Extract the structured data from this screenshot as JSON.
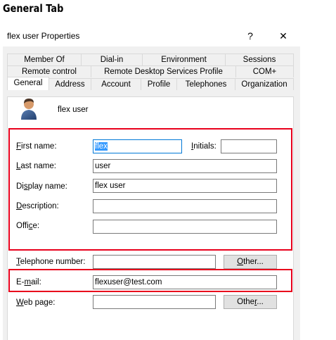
{
  "heading": "General Tab",
  "dialog": {
    "title": "flex user Properties",
    "help_glyph": "?",
    "close_glyph": "✕"
  },
  "tabs": {
    "row1": [
      "Member Of",
      "Dial-in",
      "Environment",
      "Sessions"
    ],
    "row2": [
      "Remote control",
      "Remote Desktop Services Profile",
      "COM+"
    ],
    "row3": [
      "General",
      "Address",
      "Account",
      "Profile",
      "Telephones",
      "Organization"
    ],
    "active": "General"
  },
  "user": {
    "icon": "user-icon",
    "name": "flex user"
  },
  "form": {
    "first_name_label_key": "F",
    "first_name_label_rest": "irst name:",
    "first_name_value": "flex",
    "initials_label_key": "I",
    "initials_label_rest": "nitials:",
    "initials_value": "",
    "last_name_label_key": "L",
    "last_name_label_rest": "ast name:",
    "last_name_value": "user",
    "display_name_label_pre": "Di",
    "display_name_label_key": "s",
    "display_name_label_rest": "play name:",
    "display_name_value": "flex user",
    "description_label_key": "D",
    "description_label_rest": "escription:",
    "description_value": "",
    "office_label_pre": "Offi",
    "office_label_key": "c",
    "office_label_rest": "e:",
    "office_value": "",
    "telephone_label_key": "T",
    "telephone_label_rest": "elephone number:",
    "telephone_value": "",
    "telephone_other_pre": "",
    "telephone_other_key": "O",
    "telephone_other_rest": "ther...",
    "email_label_pre": "E-",
    "email_label_key": "m",
    "email_label_rest": "ail:",
    "email_value": "flexuser@test.com",
    "webpage_label_key": "W",
    "webpage_label_rest": "eb page:",
    "webpage_value": "",
    "webpage_other_pre": "Othe",
    "webpage_other_key": "r",
    "webpage_other_rest": "..."
  },
  "colors": {
    "highlight": "#e8001c",
    "selection": "#3399ff",
    "dialog_bg": "#f0f0f0"
  }
}
